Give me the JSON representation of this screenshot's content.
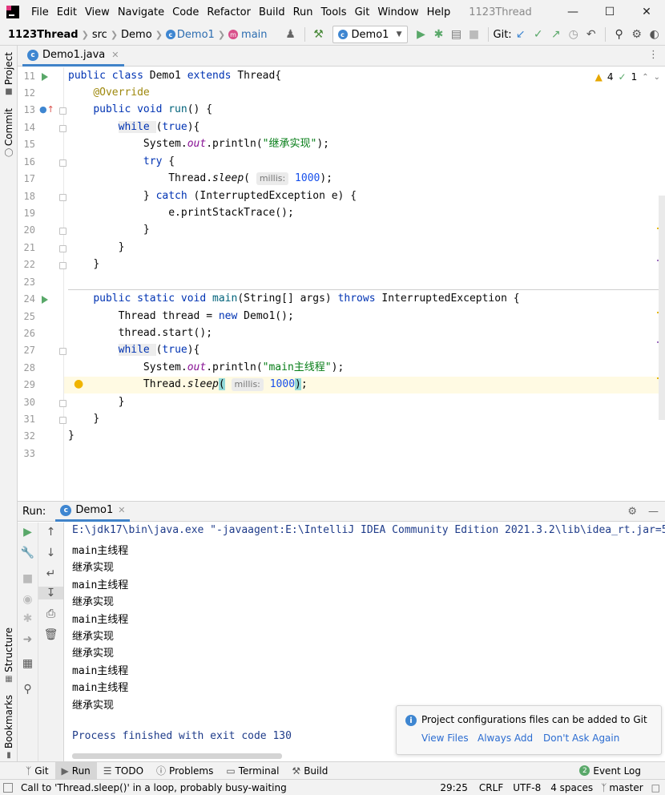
{
  "window": {
    "title": "1123Thread"
  },
  "menu": {
    "items": [
      "File",
      "Edit",
      "View",
      "Navigate",
      "Code",
      "Refactor",
      "Build",
      "Run",
      "Tools",
      "Git",
      "Window",
      "Help"
    ]
  },
  "navbar": {
    "project": "1123Thread",
    "crumbs": [
      "src",
      "Demo",
      "Demo1",
      "main"
    ],
    "run_config": "Demo1",
    "git_label": "Git:"
  },
  "editor_tab": {
    "label": "Demo1.java"
  },
  "inspections": {
    "warnings": "4",
    "ok": "1"
  },
  "left_strip": {
    "project": "Project",
    "commit": "Commit",
    "structure": "Structure",
    "bookmarks": "Bookmarks"
  },
  "code": {
    "line_numbers": [
      "11",
      "12",
      "13",
      "14",
      "15",
      "16",
      "17",
      "18",
      "19",
      "20",
      "21",
      "22",
      "23",
      "24",
      "25",
      "26",
      "27",
      "28",
      "29",
      "30",
      "31",
      "32",
      "33"
    ],
    "l11": {
      "kw1": "public class ",
      "name": "Demo1 ",
      "kw2": "extends ",
      "rest": "Thread{"
    },
    "l12": {
      "ann": "@Override"
    },
    "l13": {
      "kw": "public void ",
      "fn": "run",
      "rest": "() {"
    },
    "l14": {
      "kw": "while ",
      "paren": "(",
      "kw2": "true",
      "rest": "){"
    },
    "l15": {
      "pre": "System.",
      "field": "out",
      "mid": ".println(",
      "str": "\"继承实现\"",
      "post": ");"
    },
    "l16": {
      "kw": "try ",
      "rest": "{"
    },
    "l17": {
      "pre": "Thread.",
      "method": "sleep",
      "open": "( ",
      "hint": "millis:",
      "num": "1000",
      "post": ");"
    },
    "l18": {
      "pre": "} ",
      "kw": "catch ",
      "rest": "(InterruptedException e) {"
    },
    "l19": {
      "text": "e.printStackTrace();"
    },
    "l20": {
      "text": "}"
    },
    "l21": {
      "text": "}"
    },
    "l22": {
      "text": "}"
    },
    "l24": {
      "kw": "public static void ",
      "fn": "main",
      "mid": "(String[] args) ",
      "kw2": "throws ",
      "rest": "InterruptedException {"
    },
    "l25": {
      "pre": "Thread thread = ",
      "kw": "new ",
      "rest": "Demo1();"
    },
    "l26": {
      "text": "thread.start();"
    },
    "l27": {
      "kw": "while ",
      "paren": "(",
      "kw2": "true",
      "rest": "){"
    },
    "l28": {
      "pre": "System.",
      "field": "out",
      "mid": ".println(",
      "str": "\"main主线程\"",
      "post": ");"
    },
    "l29": {
      "pre": "Thread.",
      "method": "sleep",
      "open": "(",
      "hint": "millis:",
      "num": "1000",
      "close": ")",
      "post": ";"
    },
    "l30": {
      "text": "}"
    },
    "l31": {
      "text": "}"
    },
    "l32": {
      "text": "}"
    }
  },
  "run_panel": {
    "title": "Run:",
    "tab": "Demo1",
    "command": "E:\\jdk17\\bin\\java.exe \"-javaagent:E:\\IntelliJ IDEA Community Edition 2021.3.2\\lib\\idea_rt.jar=5",
    "output": [
      "main主线程",
      "继承实现",
      "main主线程",
      "继承实现",
      "main主线程",
      "继承实现",
      "继承实现",
      "main主线程",
      "main主线程",
      "继承实现"
    ],
    "exit": "Process finished with exit code 130"
  },
  "notification": {
    "message": "Project configurations files can be added to Git",
    "actions": [
      "View Files",
      "Always Add",
      "Don't Ask Again"
    ]
  },
  "bottom_tabs": [
    "Git",
    "Run",
    "TODO",
    "Problems",
    "Terminal",
    "Build"
  ],
  "event_log": "Event Log",
  "event_log_count": "2",
  "status": {
    "message": "Call to 'Thread.sleep()' in a loop, probably busy-waiting",
    "position": "29:25",
    "line_sep": "CRLF",
    "encoding": "UTF-8",
    "indent": "4 spaces",
    "branch": "master"
  },
  "colors": {
    "accent": "#4083c9",
    "run_green": "#59a869",
    "keyword": "#0033b3",
    "string": "#067d17"
  }
}
